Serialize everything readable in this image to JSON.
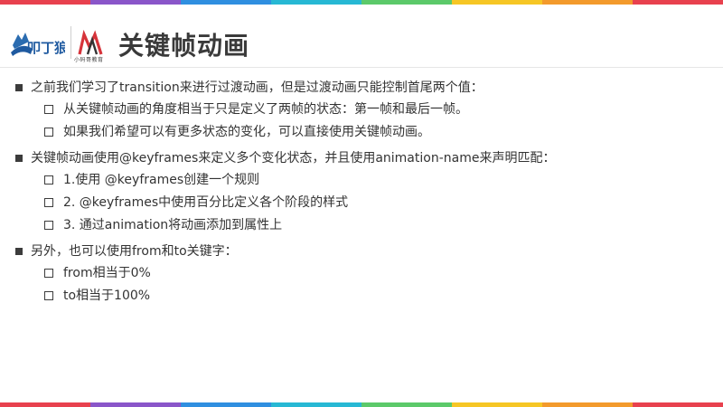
{
  "stripe_colors": [
    "#e8414e",
    "#8a56c9",
    "#2f8fe0",
    "#27b8d4",
    "#5cc96a",
    "#f6c625",
    "#f39a2c",
    "#e8414e"
  ],
  "logos": {
    "logo2_caption": "小码哥教育"
  },
  "page_title": "关键帧动画",
  "sections": [
    {
      "text": "之前我们学习了transition来进行过渡动画，但是过渡动画只能控制首尾两个值：",
      "items": [
        "从关键帧动画的角度相当于只是定义了两帧的状态：第一帧和最后一帧。",
        "如果我们希望可以有更多状态的变化，可以直接使用关键帧动画。"
      ]
    },
    {
      "text": "关键帧动画使用@keyframes来定义多个变化状态，并且使用animation-name来声明匹配：",
      "items": [
        "1.使用 @keyframes创建一个规则",
        "2. @keyframes中使用百分比定义各个阶段的样式",
        "3. 通过animation将动画添加到属性上"
      ]
    },
    {
      "text": "另外，也可以使用from和to关键字：",
      "items": [
        "from相当于0%",
        "to相当于100%"
      ]
    }
  ]
}
